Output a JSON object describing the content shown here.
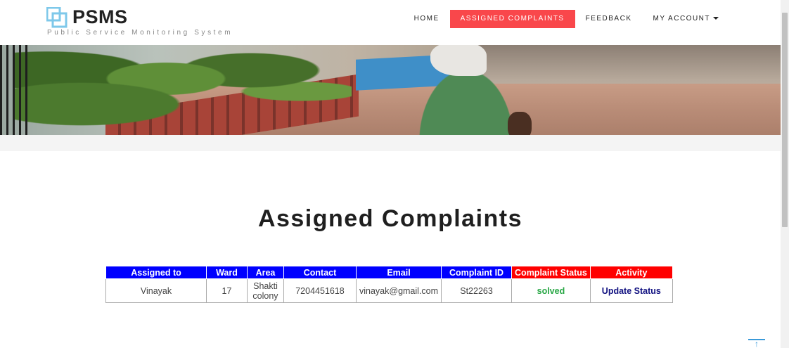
{
  "brand": {
    "name": "PSMS",
    "tagline": "Public Service Monitoring System",
    "accent": "#7ec8ea"
  },
  "nav": {
    "items": [
      {
        "label": "HOME"
      },
      {
        "label": "ASSIGNED COMPLAINTS",
        "active": true
      },
      {
        "label": "FEEDBACK"
      },
      {
        "label": "MY ACCOUNT"
      }
    ],
    "active_color": "#f9474b"
  },
  "page": {
    "title": "Assigned Complaints"
  },
  "table": {
    "headers": {
      "assigned_to": "Assigned to",
      "ward": "Ward",
      "area": "Area",
      "contact": "Contact",
      "email": "Email",
      "complaint_id": "Complaint ID",
      "complaint_status": "Complaint Status",
      "activity": "Activity"
    },
    "header_colors": {
      "blue": "#0000ff",
      "red": "#ff0000"
    },
    "rows": [
      {
        "assigned_to": "Vinayak",
        "ward": "17",
        "area_line1": "Shakti",
        "area_line2": "colony",
        "contact": "7204451618",
        "email": "vinayak@gmail.com",
        "complaint_id": "St22263",
        "complaint_status": "solved",
        "activity": "Update Status"
      }
    ]
  },
  "icons": {
    "logo": "overlapping-squares-icon",
    "dropdown": "caret-down-icon",
    "back_to_top": "arrow-up-icon"
  }
}
